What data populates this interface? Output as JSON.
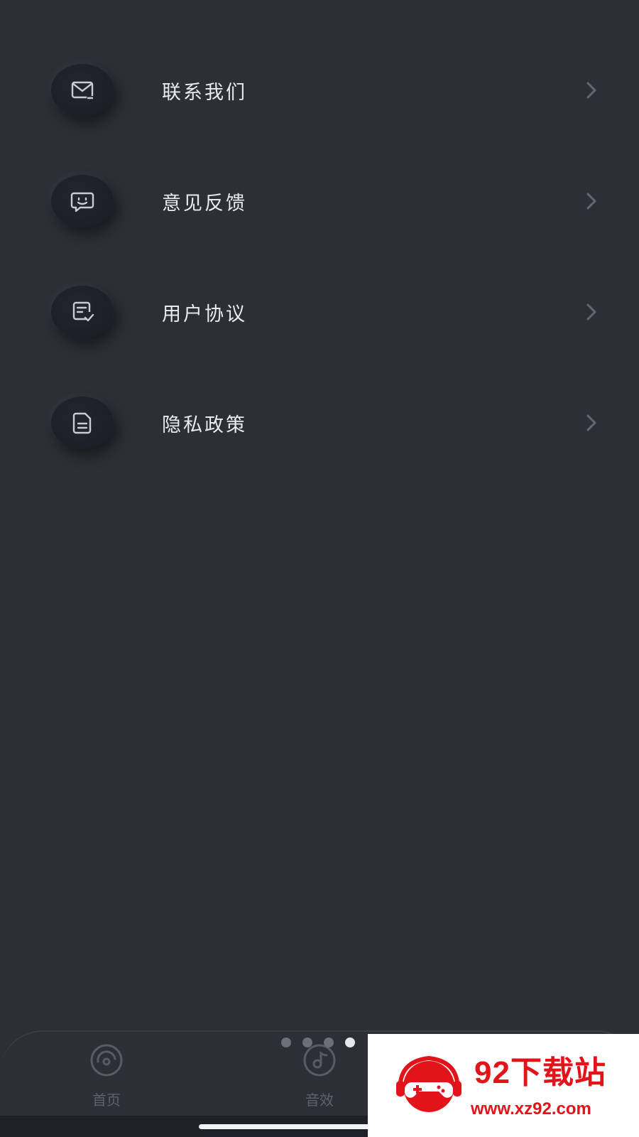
{
  "menu": {
    "items": [
      {
        "label": "联系我们",
        "icon": "mail-icon"
      },
      {
        "label": "意见反馈",
        "icon": "feedback-icon"
      },
      {
        "label": "用户协议",
        "icon": "agreement-icon"
      },
      {
        "label": "隐私政策",
        "icon": "document-icon"
      }
    ]
  },
  "tabbar": {
    "tabs": [
      {
        "label": "首页",
        "icon": "disc-icon"
      },
      {
        "label": "音效",
        "icon": "music-note-icon"
      }
    ],
    "page_indicator": {
      "count": 4,
      "active_index": 3
    }
  },
  "watermark": {
    "title": "92下载站",
    "url": "www.xz92.com"
  },
  "colors": {
    "background": "#2c2f36",
    "text": "#e9eaed",
    "muted": "#5d626c",
    "watermark_red": "#e2141a"
  }
}
